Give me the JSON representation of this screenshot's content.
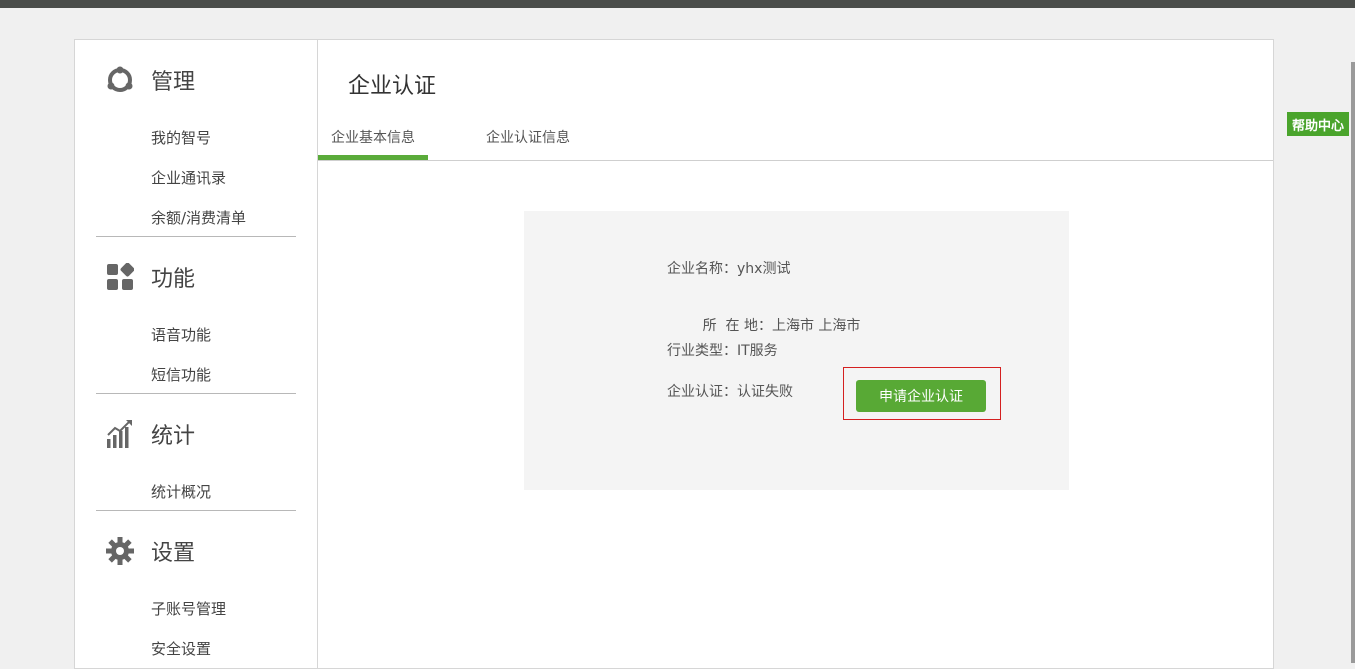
{
  "sidebar": {
    "sections": [
      {
        "title": "管理",
        "icon": "manage-icon",
        "items": [
          "我的智号",
          "企业通讯录",
          "余额/消费清单"
        ]
      },
      {
        "title": "功能",
        "icon": "apps-icon",
        "items": [
          "语音功能",
          "短信功能"
        ]
      },
      {
        "title": "统计",
        "icon": "chart-icon",
        "items": [
          "统计概况"
        ]
      },
      {
        "title": "设置",
        "icon": "gear-icon",
        "items": [
          "子账号管理",
          "安全设置"
        ]
      }
    ]
  },
  "main": {
    "title": "企业认证",
    "tabs": [
      {
        "label": "企业基本信息",
        "active": true
      },
      {
        "label": "企业认证信息",
        "active": false
      }
    ],
    "info": {
      "company_name_label": "企业名称：",
      "company_name": "yhx测试",
      "location_label": "所  在 地：",
      "location": "上海市 上海市",
      "industry_label": "行业类型：",
      "industry": "IT服务",
      "cert_label": "企业认证：",
      "cert_status": "认证失败"
    },
    "apply_button": "申请企业认证"
  },
  "help": {
    "label": "帮助中心"
  },
  "colors": {
    "accent": "#5aab3a",
    "highlight_border": "#d42020"
  }
}
